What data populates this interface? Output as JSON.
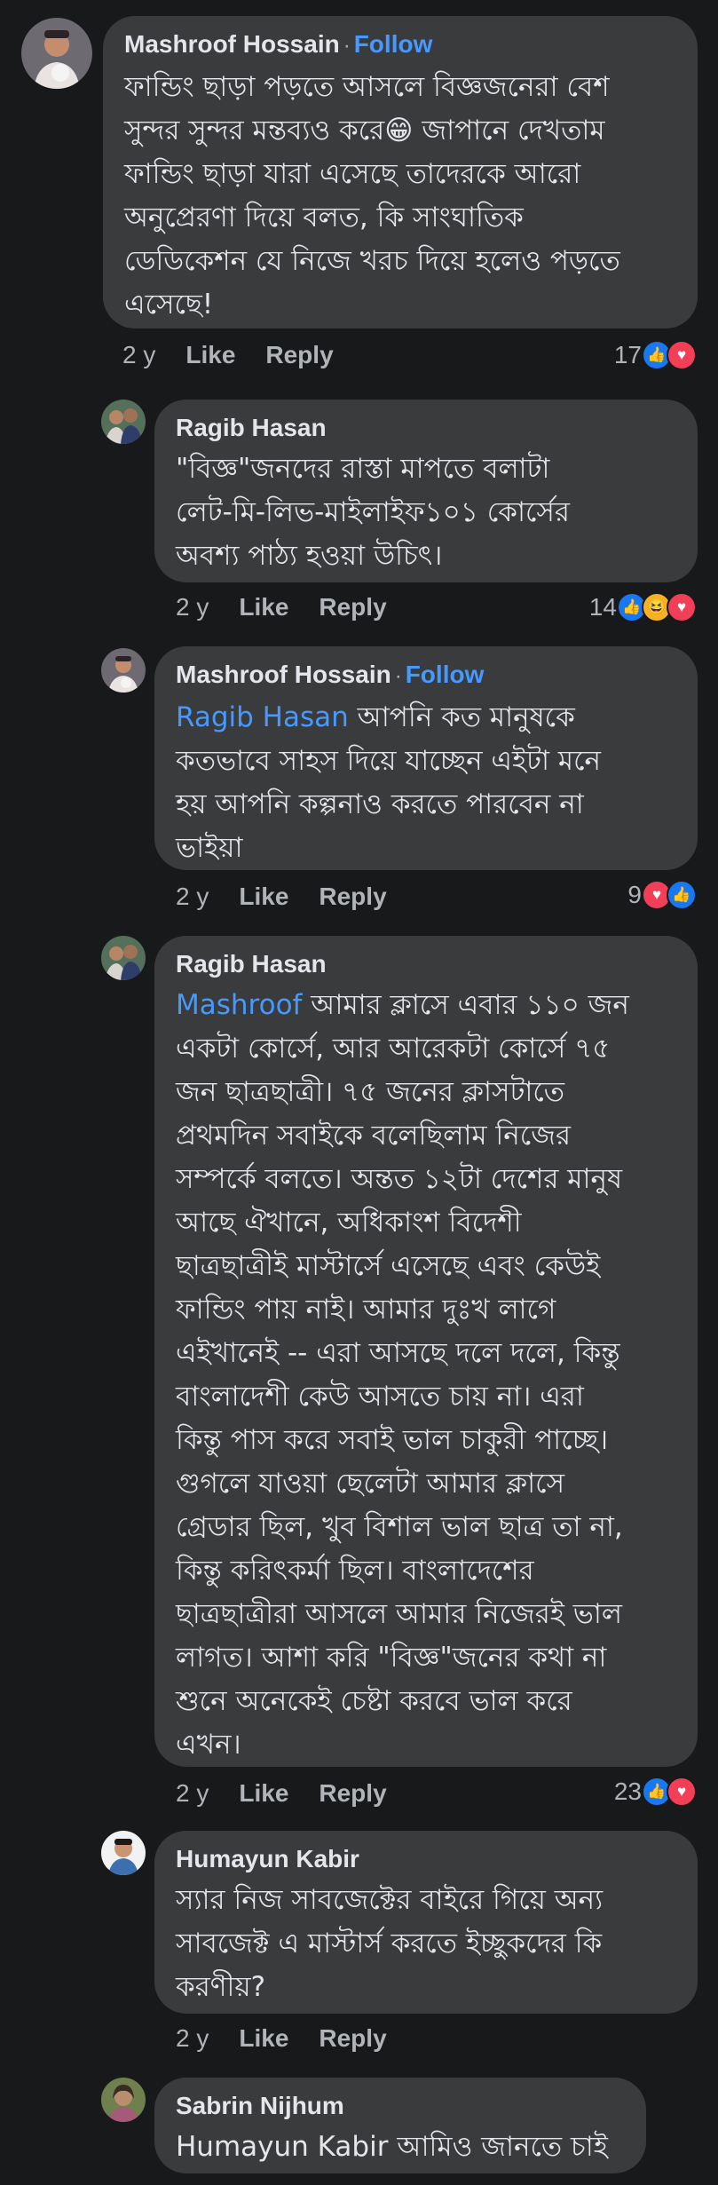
{
  "colors": {
    "background": "#18191a",
    "bubble": "#3a3b3c",
    "text": "#e4e6eb",
    "muted": "#b0b3b8",
    "link": "#4599ff",
    "like": "#1877f2",
    "love": "#f33e58",
    "haha": "#f7b125"
  },
  "comments": [
    {
      "author": "Mashroof Hossain",
      "follow_label": "Follow",
      "text_lines": [
        "ফান্ডিং ছাড়া পড়তে আসলে বিজ্ঞজনেরা বেশ",
        "সুন্দর সুন্দর মন্তব্যও করে😁 জাপানে দেখতাম",
        "ফান্ডিং ছাড়া যারা এসেছে তাদেরকে আরো",
        "অনুপ্রেরণা দিয়ে বলত, কি সাংঘাতিক",
        "ডেডিকেশন যে নিজে খরচ দিয়ে হলেও পড়তে",
        "এসেছে!"
      ],
      "time": "2 y",
      "like_label": "Like",
      "reply_label": "Reply",
      "reaction_count": "17",
      "reactions": [
        "like-icon",
        "love-icon"
      ]
    },
    {
      "author": "Ragib Hasan",
      "text_lines": [
        "\"বিজ্ঞ\"জনদের রাস্তা মাপতে বলাটা",
        "লেট-মি-লিভ-মাইলাইফ১০১ কোর্সের",
        "অবশ্য পাঠ্য হওয়া উচিৎ।"
      ],
      "time": "2 y",
      "like_label": "Like",
      "reply_label": "Reply",
      "reaction_count": "14",
      "reactions": [
        "like-icon",
        "haha-icon",
        "love-icon"
      ]
    },
    {
      "author": "Mashroof Hossain",
      "follow_label": "Follow",
      "mention": "Ragib Hasan",
      "text_lines": [
        " আপনি কত মানুষকে",
        "কতভাবে সাহস দিয়ে যাচ্ছেন এইটা মনে",
        "হয় আপনি কল্পনাও করতে পারবেন না",
        "ভাইয়া"
      ],
      "time": "2 y",
      "like_label": "Like",
      "reply_label": "Reply",
      "reaction_count": "9",
      "reactions": [
        "love-icon",
        "like-icon"
      ]
    },
    {
      "author": "Ragib Hasan",
      "mention": "Mashroof",
      "text_lines": [
        " আমার ক্লাসে এবার ১১০ জন",
        "একটা কোর্সে, আর আরেকটা কোর্সে ৭৫",
        "জন ছাত্রছাত্রী। ৭৫ জনের ক্লাসটাতে",
        "প্রথমদিন সবাইকে বলেছিলাম নিজের",
        "সম্পর্কে বলতে। অন্তত ১২টা দেশের মানুষ",
        "আছে ঐখানে, অধিকাংশ বিদেশী",
        "ছাত্রছাত্রীই মাস্টার্সে এসেছে এবং কেউই",
        "ফান্ডিং পায় নাই। আমার দুঃখ লাগে",
        "এইখানেই -- এরা আসছে দলে দলে, কিন্তু",
        "বাংলাদেশী কেউ আসতে চায় না। এরা",
        "কিন্তু পাস করে সবাই ভাল চাকুরী পাচ্ছে।",
        "গুগলে যাওয়া ছেলেটা আমার ক্লাসে",
        "গ্রেডার ছিল, খুব বিশাল ভাল ছাত্র তা না,",
        "কিন্তু করিৎকর্মা ছিল। বাংলাদেশের",
        "ছাত্রছাত্রীরা আসলে আমার নিজেরই ভাল",
        "লাগত। আশা করি \"বিজ্ঞ\"জনের কথা না",
        "শুনে অনেকেই চেষ্টা করবে ভাল করে",
        "এখন।"
      ],
      "time": "2 y",
      "like_label": "Like",
      "reply_label": "Reply",
      "reaction_count": "23",
      "reactions": [
        "like-icon",
        "love-icon"
      ]
    },
    {
      "author": "Humayun Kabir",
      "text_lines": [
        "স্যার নিজ সাবজেক্টের বাইরে গিয়ে অন্য",
        "সাবজেক্ট এ মাস্টার্স করতে ইচ্ছুকদের কি",
        "করণীয়?"
      ],
      "time": "2 y",
      "like_label": "Like",
      "reply_label": "Reply"
    },
    {
      "author": "Sabrin Nijhum",
      "mention": "Humayun Kabir",
      "text_lines": [
        " আমিও জানতে চাই"
      ]
    }
  ]
}
